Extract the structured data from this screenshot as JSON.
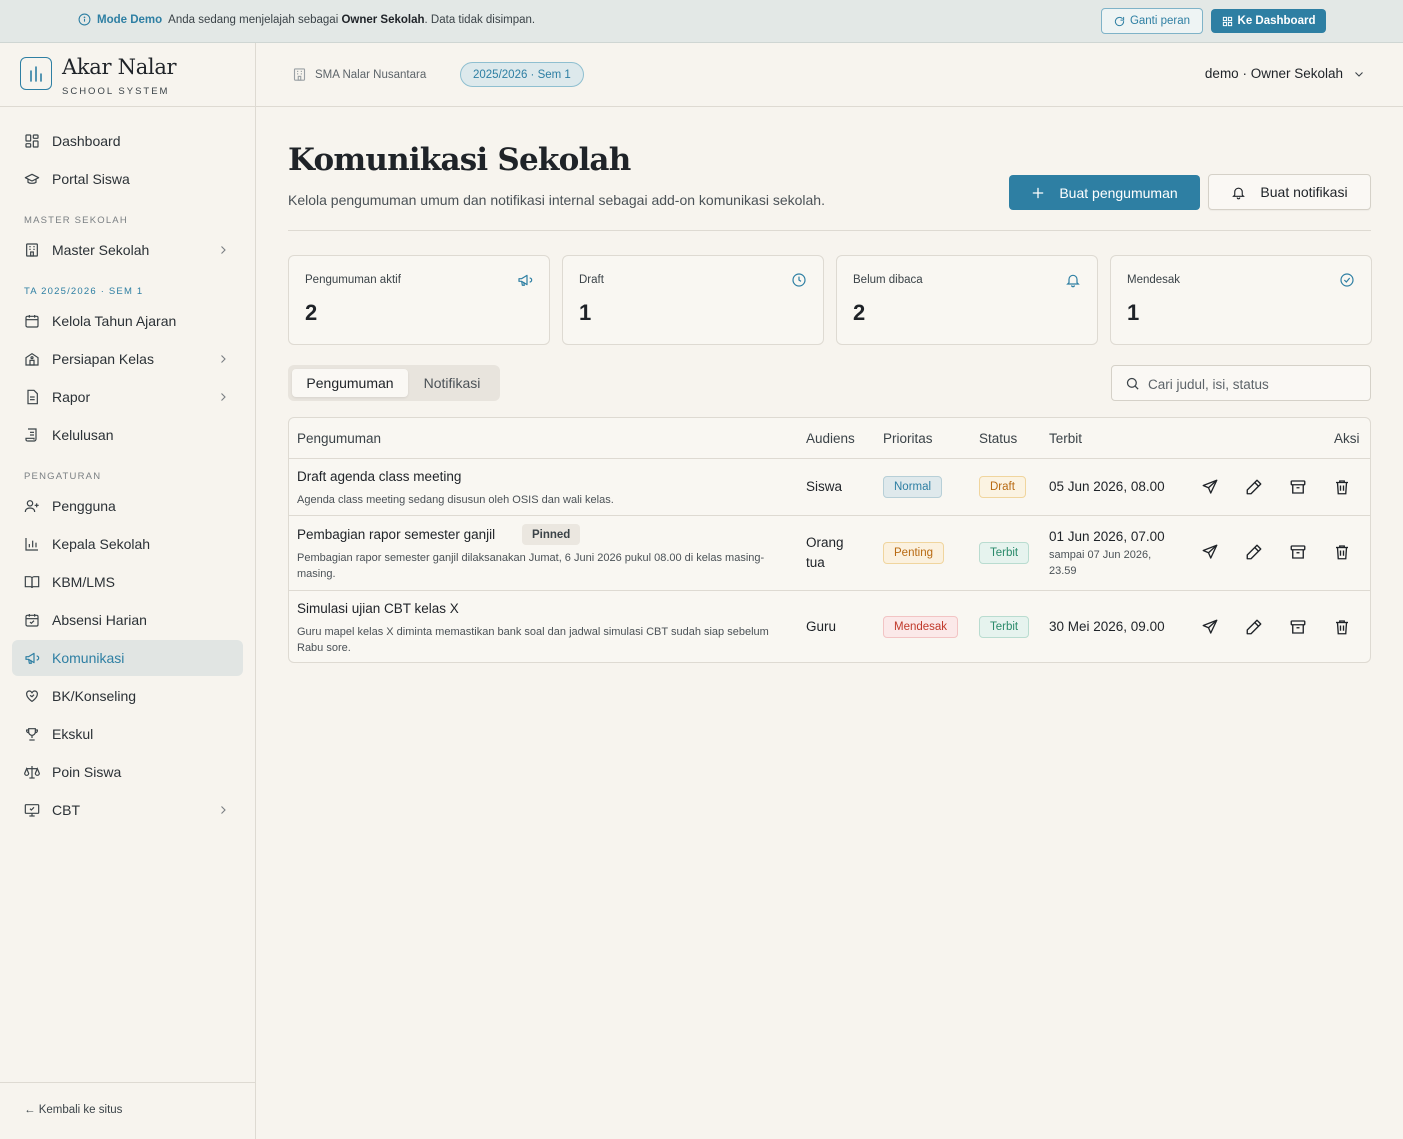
{
  "banner": {
    "mode": "Mode Demo",
    "msg_pre": "Anda sedang menjelajah sebagai ",
    "msg_bold": "Owner Sekolah",
    "msg_post": ". Data tidak disimpan.",
    "ganti_peran": "Ganti peran",
    "ke_dashboard": "Ke Dashboard"
  },
  "brand": {
    "name": "Akar Nalar",
    "sub": "SCHOOL SYSTEM"
  },
  "sidebar": {
    "items_top": [
      {
        "label": "Dashboard",
        "icon": "grid-icon"
      },
      {
        "label": "Portal Siswa",
        "icon": "graduation-cap-icon"
      }
    ],
    "section_master": "MASTER SEKOLAH",
    "master_item": {
      "label": "Master Sekolah",
      "icon": "building-icon"
    },
    "section_ta": "TA 2025/2026 · SEM 1",
    "ta_items": [
      {
        "label": "Kelola Tahun Ajaran",
        "icon": "calendar-icon"
      },
      {
        "label": "Persiapan Kelas",
        "icon": "school-icon"
      },
      {
        "label": "Rapor",
        "icon": "file-text-icon"
      },
      {
        "label": "Kelulusan",
        "icon": "scroll-icon"
      }
    ],
    "section_pengaturan": "PENGATURAN",
    "pengaturan_items": [
      {
        "label": "Pengguna",
        "icon": "user-plus-icon"
      },
      {
        "label": "Kepala Sekolah",
        "icon": "bar-chart-icon"
      },
      {
        "label": "KBM/LMS",
        "icon": "book-open-icon"
      },
      {
        "label": "Absensi Harian",
        "icon": "calendar-check-icon"
      },
      {
        "label": "Komunikasi",
        "icon": "megaphone-icon"
      },
      {
        "label": "BK/Konseling",
        "icon": "heart-handshake-icon"
      },
      {
        "label": "Ekskul",
        "icon": "trophy-icon"
      },
      {
        "label": "Poin Siswa",
        "icon": "scale-icon"
      },
      {
        "label": "CBT",
        "icon": "monitor-check-icon"
      }
    ],
    "back": "← Kembali ke situs"
  },
  "topbar": {
    "school": "SMA Nalar Nusantara",
    "year": "2025/2026 · Sem 1",
    "user": "demo · Owner Sekolah"
  },
  "page": {
    "title": "Komunikasi Sekolah",
    "subtitle": "Kelola pengumuman umum dan notifikasi internal sebagai add-on komunikasi sekolah.",
    "btn_pengumuman": "Buat pengumuman",
    "btn_notifikasi": "Buat notifikasi"
  },
  "stats": [
    {
      "label": "Pengumuman aktif",
      "value": "2",
      "icon": "megaphone-icon"
    },
    {
      "label": "Draft",
      "value": "1",
      "icon": "clock-icon"
    },
    {
      "label": "Belum dibaca",
      "value": "2",
      "icon": "bell-icon"
    },
    {
      "label": "Mendesak",
      "value": "1",
      "icon": "check-circle-icon"
    }
  ],
  "tabs": {
    "pengumuman": "Pengumuman",
    "notifikasi": "Notifikasi"
  },
  "search": {
    "placeholder": "Cari judul, isi, status"
  },
  "table": {
    "headers": [
      "Pengumuman",
      "Audiens",
      "Prioritas",
      "Status",
      "Terbit",
      "Aksi"
    ],
    "rows": [
      {
        "title": "Draft agenda class meeting",
        "desc": "Agenda class meeting sedang disusun oleh OSIS dan wali kelas.",
        "pinned": "",
        "audience": "Siswa",
        "priority": "Normal",
        "status": "Draft",
        "date": "05 Jun 2026, 08.00",
        "until": ""
      },
      {
        "title": "Pembagian rapor semester ganjil",
        "desc": "Pembagian rapor semester ganjil dilaksanakan Jumat, 6 Juni 2026 pukul 08.00 di kelas masing-masing.",
        "pinned": "Pinned",
        "audience": "Orang tua",
        "priority": "Penting",
        "status": "Terbit",
        "date": "01 Jun 2026, 07.00",
        "until": "sampai 07 Jun 2026, 23.59"
      },
      {
        "title": "Simulasi ujian CBT kelas X",
        "desc": "Guru mapel kelas X diminta memastikan bank soal dan jadwal simulasi CBT sudah siap sebelum Rabu sore.",
        "pinned": "",
        "audience": "Guru",
        "priority": "Mendesak",
        "status": "Terbit",
        "date": "30 Mei 2026, 09.00",
        "until": ""
      }
    ],
    "actions": [
      "send-icon",
      "pencil-icon",
      "archive-icon",
      "trash-icon"
    ]
  },
  "colors": {
    "accent": "#2e7fa3",
    "background": "#f7f4ee"
  }
}
